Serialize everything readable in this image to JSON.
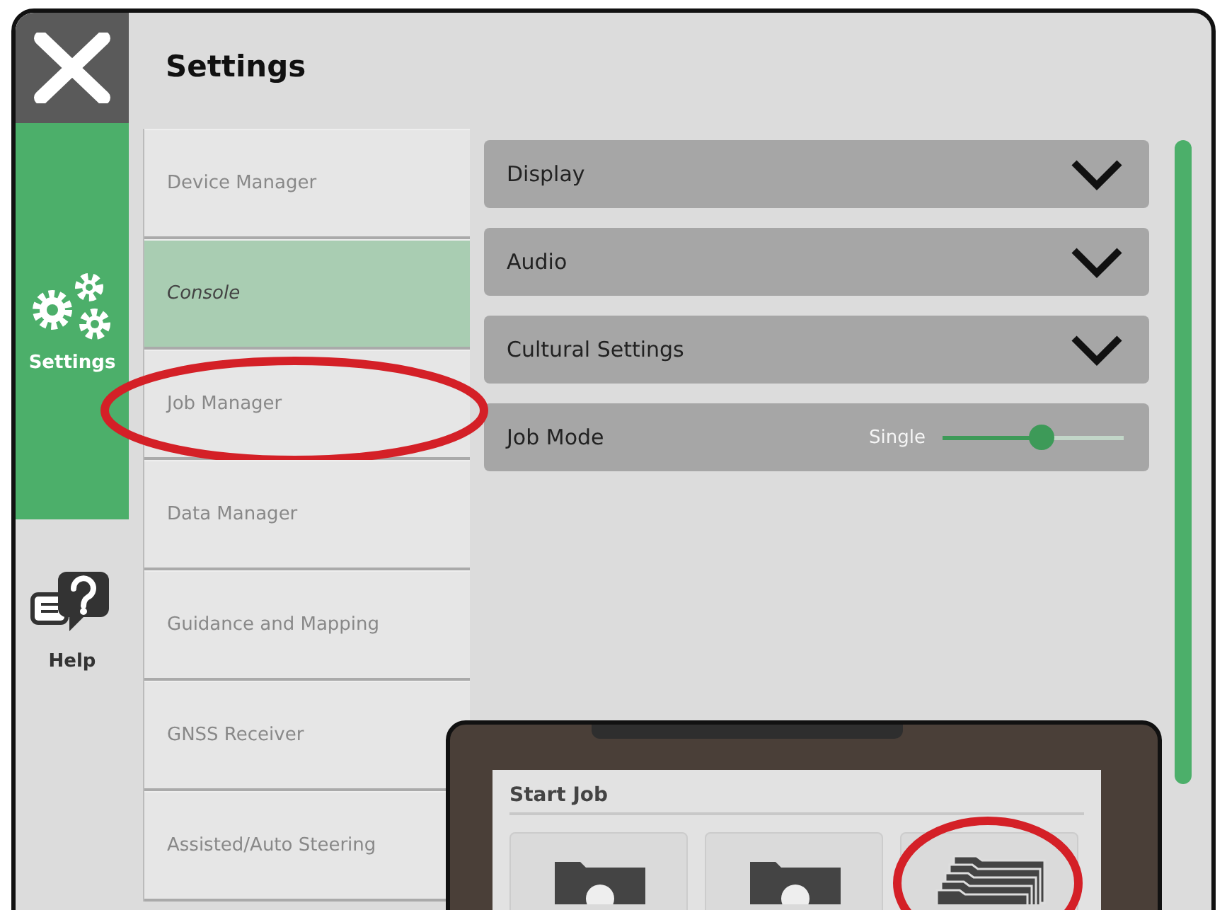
{
  "header": {
    "title": "Settings"
  },
  "rail": [
    {
      "label": "Settings",
      "kind": "settings",
      "selected": true
    },
    {
      "label": "Help",
      "kind": "help",
      "selected": false
    }
  ],
  "menu": [
    {
      "label": "Device Manager",
      "selected": false,
      "highlighted": false
    },
    {
      "label": "Console",
      "selected": true,
      "highlighted": false
    },
    {
      "label": "Job Manager",
      "selected": false,
      "highlighted": true
    },
    {
      "label": "Data Manager",
      "selected": false,
      "highlighted": false
    },
    {
      "label": "Guidance and Mapping",
      "selected": false,
      "highlighted": false
    },
    {
      "label": "GNSS Receiver",
      "selected": false,
      "highlighted": false
    },
    {
      "label": "Assisted/Auto Steering",
      "selected": false,
      "highlighted": false
    }
  ],
  "options": [
    {
      "label": "Display",
      "kind": "expandable",
      "expanded": false
    },
    {
      "label": "Audio",
      "kind": "expandable",
      "expanded": false
    },
    {
      "label": "Cultural Settings",
      "kind": "expandable",
      "expanded": false
    },
    {
      "label": "Job Mode",
      "kind": "toggle",
      "option": "Single",
      "level": 0.55
    }
  ],
  "inset": {
    "title": "Start Job",
    "tiles": [
      {
        "kind": "folder-play",
        "highlighted": false
      },
      {
        "kind": "folder-info",
        "highlighted": false
      },
      {
        "kind": "folders",
        "highlighted": true
      }
    ]
  }
}
